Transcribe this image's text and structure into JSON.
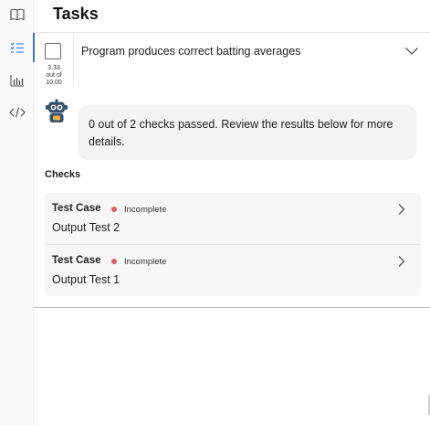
{
  "rail": {
    "items": [
      {
        "icon": "book-icon",
        "active": false
      },
      {
        "icon": "checklist-icon",
        "active": true
      },
      {
        "icon": "bar-chart-icon",
        "active": false
      },
      {
        "icon": "code-icon",
        "active": false
      }
    ]
  },
  "header": {
    "title": "Tasks"
  },
  "task": {
    "name": "Program produces correct batting averages",
    "score": "3.33",
    "score_out_of": "out of",
    "score_max": "10.00"
  },
  "feedback": {
    "message": "0 out of 2 checks passed. Review the results below for more details."
  },
  "checks": {
    "heading": "Checks",
    "items": [
      {
        "title": "Test Case",
        "status": "Incomplete",
        "name": "Output Test 2"
      },
      {
        "title": "Test Case",
        "status": "Incomplete",
        "name": "Output Test 1"
      }
    ]
  },
  "colors": {
    "accent": "#3f72cf",
    "status_incomplete": "#e05d65"
  }
}
